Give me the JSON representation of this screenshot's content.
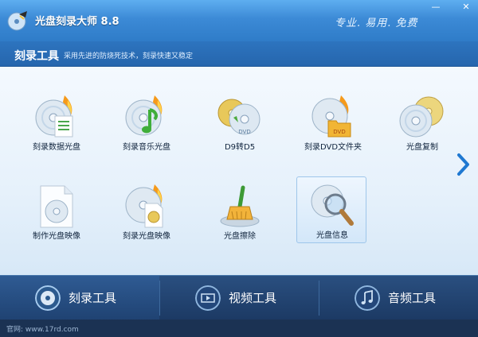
{
  "window": {
    "title": "光盘刻录大师 8.8",
    "slogan": "专业. 易用. 免费",
    "controls": {
      "minimize": "—",
      "close": "✕"
    }
  },
  "section": {
    "title": "刻录工具",
    "description": "采用先进的防烧死技术，刻录快速又稳定"
  },
  "tools": [
    {
      "label": "刻录数据光盘",
      "icon": "burn-data-disc-icon"
    },
    {
      "label": "刻录音乐光盘",
      "icon": "burn-music-disc-icon"
    },
    {
      "label": "D9转D5",
      "icon": "d9-to-d5-icon"
    },
    {
      "label": "刻录DVD文件夹",
      "icon": "burn-dvd-folder-icon"
    },
    {
      "label": "光盘复制",
      "icon": "disc-copy-icon"
    },
    {
      "label": "制作光盘映像",
      "icon": "make-disc-image-icon"
    },
    {
      "label": "刻录光盘映像",
      "icon": "burn-disc-image-icon"
    },
    {
      "label": "光盘擦除",
      "icon": "disc-erase-icon"
    },
    {
      "label": "光盘信息",
      "icon": "disc-info-icon",
      "selected": true
    }
  ],
  "nav": {
    "tabs": [
      {
        "label": "刻录工具",
        "icon": "disc-icon",
        "active": true
      },
      {
        "label": "视频工具",
        "icon": "film-icon"
      },
      {
        "label": "音频工具",
        "icon": "music-note-icon"
      }
    ]
  },
  "footer": {
    "text": "官网: www.17rd.com"
  },
  "colors": {
    "accent": "#2f7cc8",
    "nav_bg": "#1c3a64",
    "flame": "#f59a1b"
  }
}
